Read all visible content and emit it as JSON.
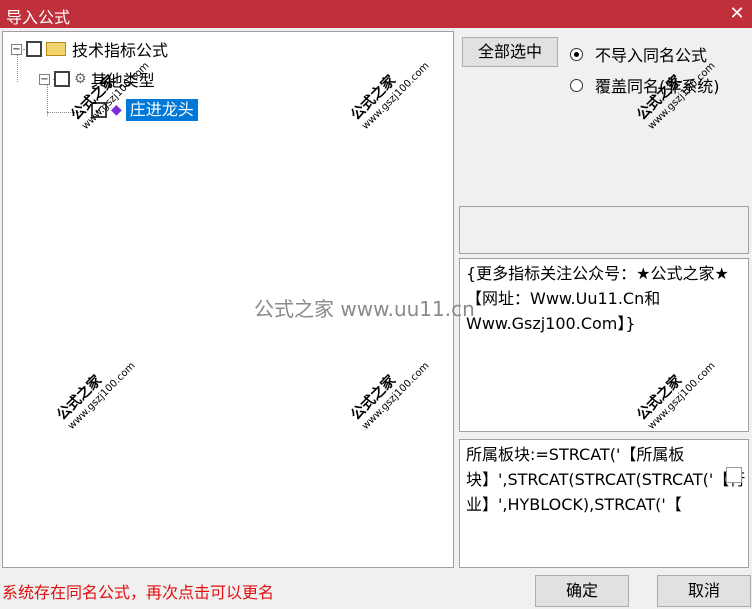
{
  "window": {
    "title": "导入公式",
    "close_glyph": "✕"
  },
  "tree": {
    "nodes": [
      {
        "label": "技术指标公式",
        "expander": "−",
        "checked": false
      },
      {
        "label": "其他类型",
        "expander": "−",
        "checked": false
      },
      {
        "label": "庄进龙头",
        "checked": true,
        "selected": true
      }
    ]
  },
  "options": {
    "select_all_label": "全部选中",
    "radio_no_import": "不导入同名公式",
    "radio_overwrite": "覆盖同名(非系统)",
    "selected_option": "no_import"
  },
  "description_text": "{更多指标关注公众号：★公式之家★【网址：Www.Uu11.Cn和Www.Gszj100.Com】}",
  "formula_text": "所属板块:=STRCAT('【所属板块】',STRCAT(STRCAT(STRCAT('【行业】',HYBLOCK),STRCAT('【",
  "status_message": "系统存在同名公式，再次点击可以更名",
  "buttons": {
    "ok": "确定",
    "cancel": "取消"
  },
  "watermark": {
    "text": "公式之家",
    "url": "www.gszj100.com",
    "center_text": "公式之家 www.uu11.cn"
  }
}
